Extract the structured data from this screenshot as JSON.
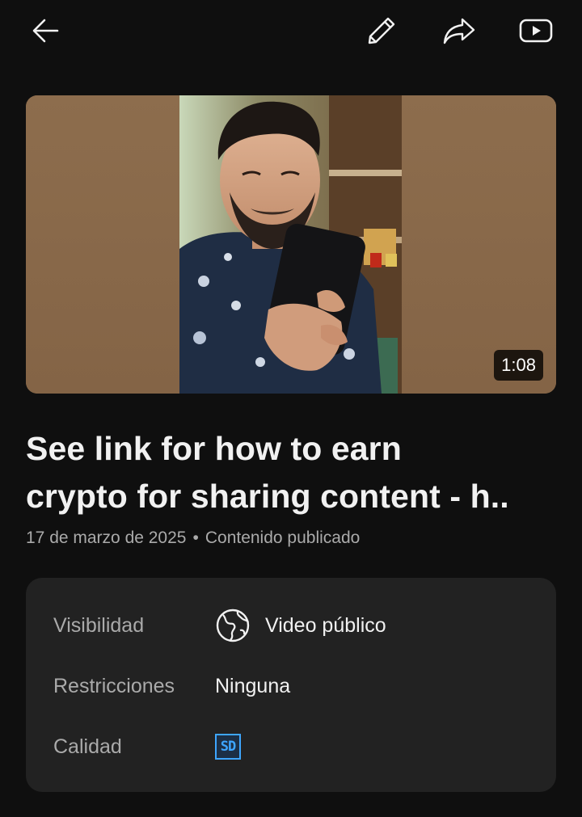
{
  "header": {
    "back_icon": "arrow-left-icon",
    "edit_icon": "pencil-icon",
    "share_icon": "share-arrow-icon",
    "youtube_icon": "youtube-play-icon"
  },
  "video": {
    "duration": "1:08",
    "title_line1": "See link for how to earn",
    "title_line2": "crypto for sharing content - h..",
    "date": "17 de marzo de 2025",
    "separator": "•",
    "status": "Contenido publicado"
  },
  "details": {
    "visibility_label": "Visibilidad",
    "visibility_value": "Video público",
    "visibility_icon": "globe-icon",
    "restrictions_label": "Restricciones",
    "restrictions_value": "Ninguna",
    "quality_label": "Calidad",
    "quality_value": "SD"
  },
  "colors": {
    "background": "#0f0f0f",
    "card": "#222222",
    "muted_text": "#aaaaaa",
    "accent_blue": "#3ea6ff"
  }
}
